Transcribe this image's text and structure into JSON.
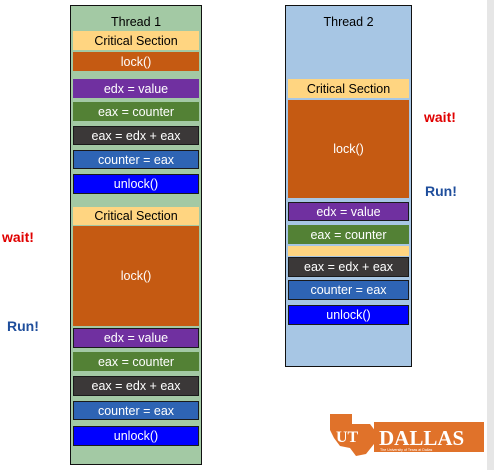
{
  "colors": {
    "thread_header": "#a3c9a4",
    "thread2_bg": "#a7c6e4",
    "critical_section": "#ffd581",
    "lock": "#c55a12",
    "edx": "#7030a0",
    "eax_counter": "#538135",
    "eax_sum": "#3b3838",
    "counter_eax": "#2e64b4",
    "unlock": "#0000ff",
    "wait": "#e00000",
    "run": "#1f4e9c",
    "logo_orange": "#e0722a"
  },
  "thread1": {
    "title": "Thread 1",
    "section_1": {
      "critical": "Critical Section",
      "lock": "lock()",
      "edx": "edx = value",
      "eax_counter": "eax = counter",
      "eax_sum": "eax = edx + eax",
      "counter_eax": "counter = eax",
      "unlock": "unlock()"
    },
    "section_2": {
      "critical": "Critical Section",
      "lock": "lock()",
      "edx": "edx = value",
      "eax_counter": "eax = counter",
      "eax_sum": "eax = edx + eax",
      "counter_eax": "counter = eax",
      "unlock": "unlock()"
    },
    "wait_label": "wait!",
    "run_label": "Run!"
  },
  "thread2": {
    "title": "Thread 2",
    "critical": "Critical Section",
    "lock": "lock()",
    "edx": "edx = value",
    "eax_counter": "eax = counter",
    "eax_sum": "eax = edx + eax",
    "counter_eax": "counter = eax",
    "unlock": "unlock()",
    "wait_label": "wait!",
    "run_label": "Run!"
  },
  "logo": {
    "initials": "UT",
    "name": "DALLAS",
    "tagline": "The University of Texas at Dallas",
    "icon": "ut-dallas-logo"
  }
}
